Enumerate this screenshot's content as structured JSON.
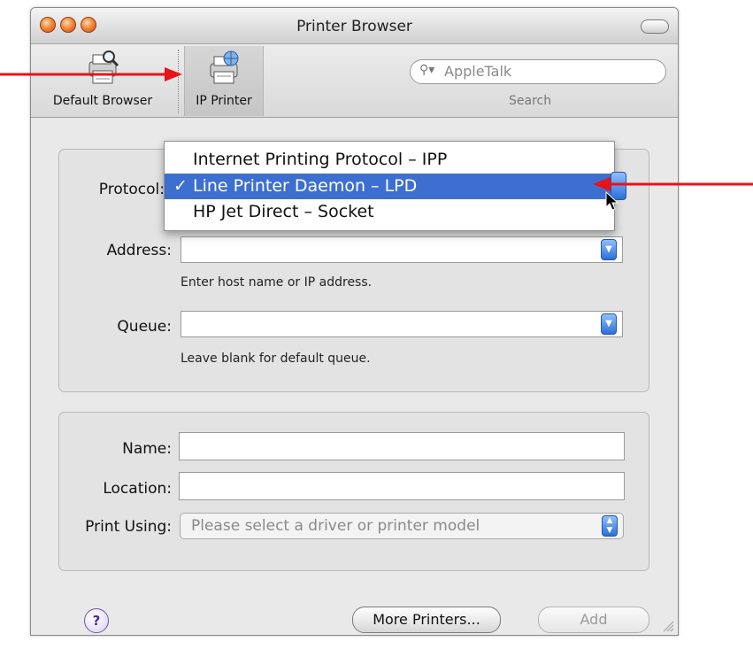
{
  "window": {
    "title": "Printer Browser"
  },
  "toolbar": {
    "default_browser": "Default Browser",
    "ip_printer": "IP Printer",
    "search_placeholder": "AppleTalk",
    "search_label": "Search"
  },
  "protocol": {
    "label": "Protocol:"
  },
  "protocol_menu": {
    "items": [
      {
        "label": "Internet Printing Protocol – IPP",
        "selected": false
      },
      {
        "label": "Line Printer Daemon – LPD",
        "selected": true
      },
      {
        "label": "HP Jet Direct – Socket",
        "selected": false
      }
    ],
    "checkmark": "✓"
  },
  "address": {
    "label": "Address:",
    "value": "",
    "hint": "Enter host name or IP address."
  },
  "queue": {
    "label": "Queue:",
    "value": "",
    "hint": "Leave blank for default queue."
  },
  "name": {
    "label": "Name:",
    "value": ""
  },
  "location": {
    "label": "Location:",
    "value": ""
  },
  "print_using": {
    "label": "Print Using:",
    "value": "Please select a driver or printer model"
  },
  "buttons": {
    "help": "?",
    "more_printers": "More Printers...",
    "add": "Add"
  },
  "colors": {
    "accent": "#3d6fd0",
    "annotation_arrow": "#e8121a",
    "traffic_light": "#f08a3a"
  }
}
